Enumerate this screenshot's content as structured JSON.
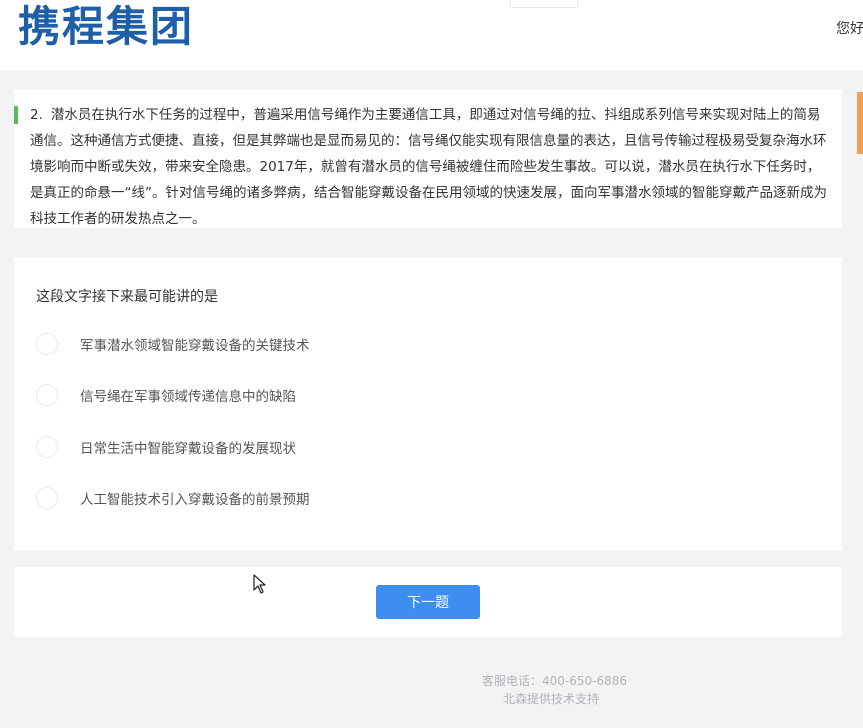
{
  "header": {
    "logo": "携程集团",
    "greeting": "您好"
  },
  "question": {
    "number": "2.",
    "text": "潜水员在执行水下任务的过程中，普遍采用信号绳作为主要通信工具，即通过对信号绳的拉、抖组成系列信号来实现对陆上的简易通信。这种通信方式便捷、直接，但是其弊端也是显而易见的：信号绳仅能实现有限信息量的表达，且信号传输过程极易受复杂海水环境影响而中断或失效，带来安全隐患。2017年，就曾有潜水员的信号绳被缠住而险些发生事故。可以说，潜水员在执行水下任务时，是真正的命悬一“线”。针对信号绳的诸多弊病，结合智能穿戴设备在民用领域的快速发展，面向军事潜水领域的智能穿戴产品逐新成为科技工作者的研发热点之一。"
  },
  "prompt": "这段文字接下来最可能讲的是",
  "options": [
    {
      "label": "军事潜水领域智能穿戴设备的关键技术"
    },
    {
      "label": "信号绳在军事领域传递信息中的缺陷"
    },
    {
      "label": "日常生活中智能穿戴设备的发展现状"
    },
    {
      "label": "人工智能技术引入穿戴设备的前景预期"
    }
  ],
  "next_button": "下一题",
  "footer": {
    "phone": "客服电话：400-650-6886",
    "support": "北森提供技术支持"
  },
  "colors": {
    "brand": "#1f5fa8",
    "accent": "#3d8ef0",
    "marker": "#5cb85c",
    "side_tab": "#f0a050"
  }
}
